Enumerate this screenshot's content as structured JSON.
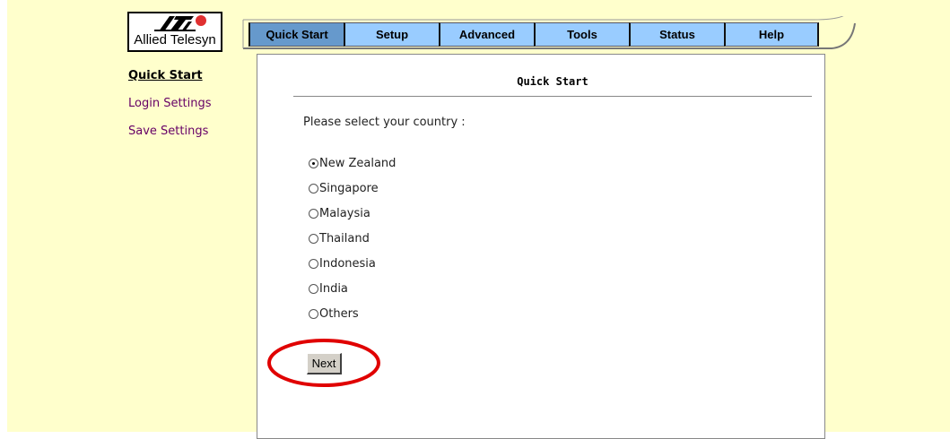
{
  "brand": {
    "name": "Allied Telesyn"
  },
  "nav": {
    "tabs": [
      {
        "label": "Quick Start",
        "active": true
      },
      {
        "label": "Setup",
        "active": false
      },
      {
        "label": "Advanced",
        "active": false
      },
      {
        "label": "Tools",
        "active": false
      },
      {
        "label": "Status",
        "active": false
      },
      {
        "label": "Help",
        "active": false
      }
    ]
  },
  "sidebar": {
    "items": [
      {
        "label": "Quick Start",
        "active": true
      },
      {
        "label": "Login Settings",
        "active": false
      },
      {
        "label": "Save Settings",
        "active": false
      }
    ]
  },
  "main": {
    "title": "Quick Start",
    "prompt": "Please select your country :",
    "countries": [
      {
        "label": "New Zealand",
        "checked": true
      },
      {
        "label": "Singapore",
        "checked": false
      },
      {
        "label": "Malaysia",
        "checked": false
      },
      {
        "label": "Thailand",
        "checked": false
      },
      {
        "label": "Indonesia",
        "checked": false
      },
      {
        "label": "India",
        "checked": false
      },
      {
        "label": "Others",
        "checked": false
      }
    ],
    "next_label": "Next"
  },
  "colors": {
    "page_bg": "#ffffcc",
    "tab_bg": "#99ccff",
    "tab_active_bg": "#6699cc",
    "sidebar_link": "#660066",
    "highlight": "#e00000"
  },
  "icons": {
    "logo": "allied-telesyn-logo-icon",
    "radio": "radio-button-icon"
  }
}
